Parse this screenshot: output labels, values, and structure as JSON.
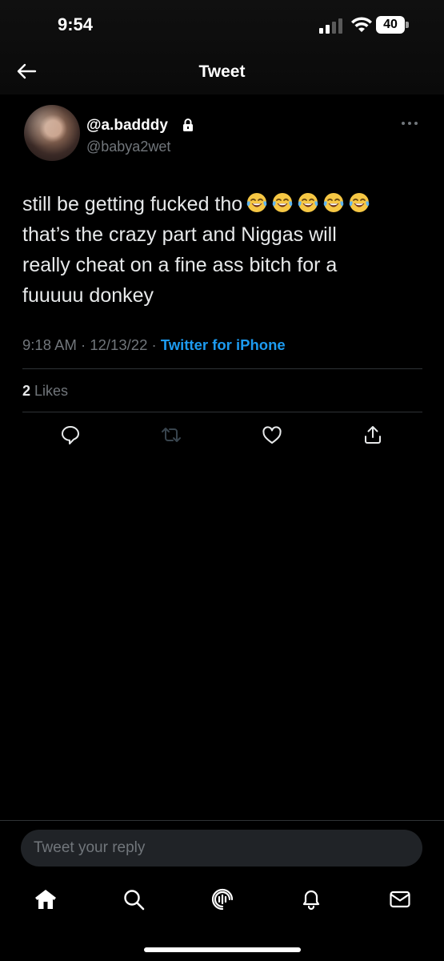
{
  "status_bar": {
    "time": "9:54",
    "battery": "40"
  },
  "header": {
    "title": "Tweet"
  },
  "tweet": {
    "display_name": "@a.badddy",
    "handle": "@babya2wet",
    "lines": [
      "still be getting fucked tho",
      "that’s the crazy part and Niggas will",
      "really cheat on a fine ass bitch for a",
      "fuuuuu donkey"
    ],
    "emoji_count": 5,
    "time": "9:18 AM",
    "date": "12/13/22",
    "source": "Twitter for iPhone",
    "likes_count": "2",
    "likes_label": "Likes"
  },
  "reply": {
    "placeholder": "Tweet your reply"
  },
  "colors": {
    "accent": "#1d9bf0",
    "background": "#000000",
    "secondary_text": "#71767b"
  },
  "icons": {
    "actions": [
      "reply-icon",
      "retweet-icon",
      "like-icon",
      "share-icon"
    ],
    "nav": [
      "home-icon",
      "search-icon",
      "spaces-icon",
      "notifications-icon",
      "messages-icon"
    ]
  }
}
